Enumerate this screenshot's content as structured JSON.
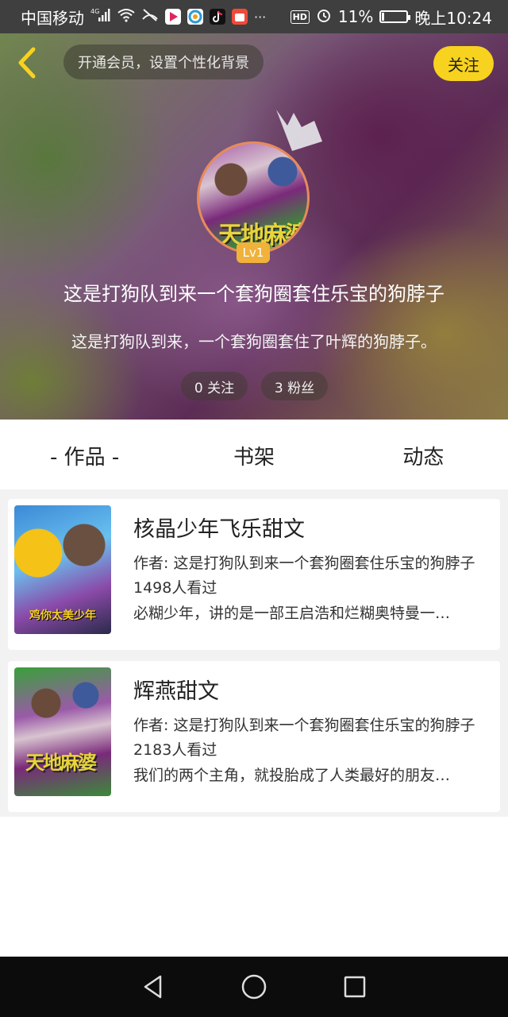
{
  "status_bar": {
    "carrier": "中国移动",
    "network": "4G",
    "hd": "HD",
    "battery_percent_text": "11%",
    "battery_level": 0.11,
    "time": "晚上10:24",
    "more": "···"
  },
  "header": {
    "vip_banner": "开通会员，设置个性化背景",
    "follow_label": "关注"
  },
  "profile": {
    "level": "Lv1",
    "nickname": "这是打狗队到来一个套狗圈套住乐宝的狗脖子",
    "signature": "这是打狗队到来，一个套狗圈套住了叶辉的狗脖子。",
    "following": "0 关注",
    "fans": "3 粉丝",
    "avatar_text": "天地麻婆"
  },
  "tabs": [
    {
      "label": "- 作品 -",
      "active": true
    },
    {
      "label": "书架",
      "active": false
    },
    {
      "label": "动态",
      "active": false
    }
  ],
  "works": [
    {
      "title": "核晶少年飞乐甜文",
      "author": "作者: 这是打狗队到来一个套狗圈套住乐宝的狗脖子",
      "views": "1498人看过",
      "description": "必糊少年，讲的是一部王启浩和烂糊奥特曼一…",
      "cover_caption": "鸡你太美少年"
    },
    {
      "title": "辉燕甜文",
      "author": "作者: 这是打狗队到来一个套狗圈套住乐宝的狗脖子",
      "views": "2183人看过",
      "description": "我们的两个主角，就投胎成了人类最好的朋友…",
      "cover_caption": "天地麻婆"
    }
  ],
  "colors": {
    "accent_yellow": "#f7d21e",
    "level_badge": "#f0b23a",
    "avatar_ring": "#e88a5a"
  },
  "icons": {
    "back": "chevron-left-icon",
    "nav_back": "triangle-back-icon",
    "nav_home": "circle-home-icon",
    "nav_recent": "square-recent-icon"
  }
}
